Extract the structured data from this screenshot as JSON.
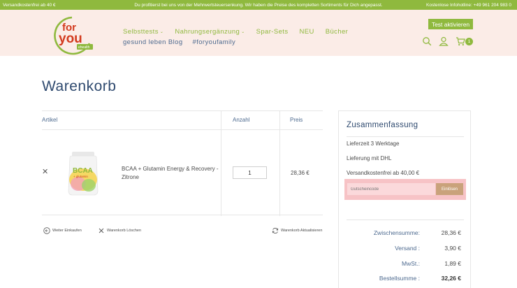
{
  "topbar": {
    "left": "Versandkostenfrei ab 40 €",
    "center": "Du profitierst bei uns von der Mehrwertsteuersenkung. Wir haben die Preise des kompletten Sortiments für Dich angepasst.",
    "right": "Kostenlose Infohotline: +49 961 204 983 0"
  },
  "logo": {
    "line1": "for",
    "line2": "you",
    "tag": "ehealth"
  },
  "nav": {
    "row1": [
      {
        "label": "Selbsttests",
        "dropdown": true
      },
      {
        "label": "Nahrungsergänzung",
        "dropdown": true
      },
      {
        "label": "Spar-Sets",
        "dropdown": false
      },
      {
        "label": "NEU",
        "dropdown": false
      },
      {
        "label": "Bücher",
        "dropdown": false
      }
    ],
    "row2": [
      {
        "label": "gesund leben Blog"
      },
      {
        "label": "#foryoufamily"
      }
    ],
    "test_button": "Test aktivieren",
    "cart_count": "1"
  },
  "page_title": "Warenkorb",
  "cart": {
    "headers": {
      "article": "Artikel",
      "quantity": "Anzahl",
      "price": "Preis"
    },
    "items": [
      {
        "name": "BCAA + Glutamin Energy & Recovery - Zitrone",
        "quantity": "1",
        "price": "28,36 €",
        "image_label": "BCAA",
        "image_sub": "+ glutamin"
      }
    ],
    "actions": {
      "continue": "Weiter Einkaufen",
      "clear": "Warenkorb Löschen",
      "update": "Warenkorb Aktualisieren"
    }
  },
  "summary": {
    "title": "Zusammenfassung",
    "delivery_time": "Lieferzeit 3 Werktage",
    "shipping_carrier": "Lieferung mit DHL",
    "free_shipping": "Versandkostenfrei ab 40,00 €",
    "coupon_placeholder": "Gutscheincode",
    "coupon_button": "Einlösen",
    "totals": [
      {
        "label": "Zwischensumme:",
        "value": "28,36 €",
        "bold": false
      },
      {
        "label": "Versand :",
        "value": "3,90 €",
        "bold": false
      },
      {
        "label": "MwSt.:",
        "value": "1,89 €",
        "bold": false
      },
      {
        "label": "Bestellsumme :",
        "value": "32,26 €",
        "bold": true
      }
    ]
  },
  "colors": {
    "green": "#8fb93e",
    "header_bg": "#fbece7",
    "navy": "#2f4a6f",
    "coupon_highlight": "#f7c3c6",
    "coupon_button": "#c9a27b"
  }
}
